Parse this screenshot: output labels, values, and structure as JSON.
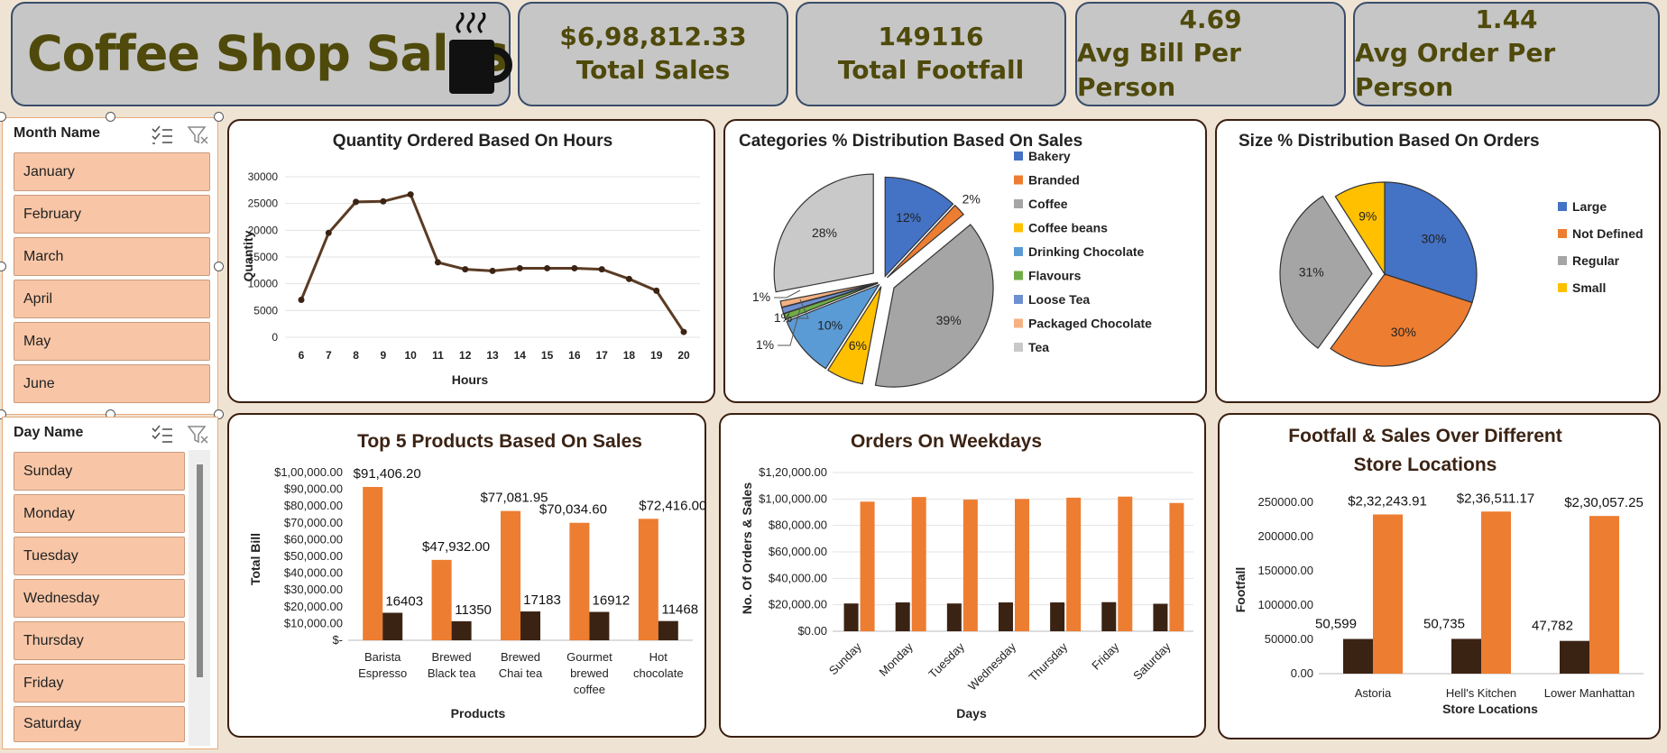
{
  "header": {
    "title": "Coffee Shop Sales",
    "icon": "coffee-cup-icon"
  },
  "kpis": [
    {
      "value": "$6,98,812.33",
      "label": "Total Sales"
    },
    {
      "value": "149116",
      "label": "Total Footfall"
    },
    {
      "value": "4.69",
      "label": "Avg Bill Per Person"
    },
    {
      "value": "1.44",
      "label": "Avg Order Per Person"
    }
  ],
  "slicers": {
    "month": {
      "header": "Month Name",
      "items": [
        "January",
        "February",
        "March",
        "April",
        "May",
        "June"
      ]
    },
    "day": {
      "header": "Day Name",
      "items": [
        "Sunday",
        "Monday",
        "Tuesday",
        "Wednesday",
        "Thursday",
        "Friday",
        "Saturday"
      ]
    }
  },
  "colors": {
    "orange": "#ed7d31",
    "dark_brown": "#3b2314",
    "line_brown": "#5b3b24",
    "title_olive": "#4f4a0b"
  },
  "chart_data": [
    {
      "type": "line",
      "title": "Quantity Ordered Based On Hours",
      "xlabel": "Hours",
      "ylabel": "Quantity",
      "x": [
        6,
        7,
        8,
        9,
        10,
        11,
        12,
        13,
        14,
        15,
        16,
        17,
        18,
        19,
        20
      ],
      "values": [
        7000,
        19500,
        25300,
        25400,
        26700,
        14000,
        12700,
        12400,
        12900,
        12900,
        12900,
        12700,
        10900,
        8700,
        1000
      ],
      "yticks": [
        "0",
        "5000",
        "10000",
        "15000",
        "20000",
        "25000",
        "30000"
      ],
      "ylim": [
        0,
        30000
      ]
    },
    {
      "type": "pie",
      "title": "Categories % Distribution Based On Sales",
      "categories": [
        "Bakery",
        "Branded",
        "Coffee",
        "Coffee beans",
        "Drinking Chocolate",
        "Flavours",
        "Loose Tea",
        "Packaged Chocolate",
        "Tea"
      ],
      "values": [
        12,
        2,
        39,
        6,
        10,
        1,
        1,
        1,
        28
      ],
      "labels": [
        "12%",
        "2%",
        "39%",
        "6%",
        "10%",
        "1%",
        "1%",
        "1%",
        "28%"
      ],
      "colors": [
        "#4472c4",
        "#ed7d31",
        "#a5a5a5",
        "#ffc000",
        "#5b9bd5",
        "#70ad47",
        "#6f8fd0",
        "#f4b183",
        "#c9c9c9"
      ],
      "legend": "right"
    },
    {
      "type": "pie",
      "title": "Size % Distribution Based On Orders",
      "categories": [
        "Large",
        "Not Defined",
        "Regular",
        "Small"
      ],
      "values": [
        30,
        30,
        31,
        9
      ],
      "labels": [
        "30%",
        "30%",
        "31%",
        "9%"
      ],
      "colors": [
        "#4472c4",
        "#ed7d31",
        "#a5a5a5",
        "#ffc000"
      ],
      "legend": "right"
    },
    {
      "type": "bar",
      "title": "Top 5 Products Based On Sales",
      "xlabel": "Products",
      "ylabel": "Total Bill",
      "categories": [
        [
          "Barista",
          "Espresso"
        ],
        [
          "Brewed",
          "Black tea"
        ],
        [
          "Brewed",
          "Chai tea"
        ],
        [
          "Gourmet",
          "brewed",
          "coffee"
        ],
        [
          "Hot",
          "chocolate"
        ]
      ],
      "series": [
        {
          "values": [
            91406.2,
            47932.0,
            77081.95,
            70034.6,
            72416.0
          ],
          "labels": [
            "$91,406.20",
            "$47,932.00",
            "$77,081.95",
            "$70,034.60",
            "$72,416.00"
          ]
        },
        {
          "values": [
            16403,
            11350,
            17183,
            16912,
            11468
          ],
          "labels": [
            "16403",
            "11350",
            "17183",
            "16912",
            "11468"
          ]
        }
      ],
      "yticks": [
        "$-",
        "$10,000.00",
        "$20,000.00",
        "$30,000.00",
        "$40,000.00",
        "$50,000.00",
        "$60,000.00",
        "$70,000.00",
        "$80,000.00",
        "$90,000.00",
        "$1,00,000.00"
      ],
      "ylim": [
        0,
        100000
      ]
    },
    {
      "type": "bar",
      "title": "Orders On Weekdays",
      "xlabel": "Days",
      "ylabel": "No. Of Orders & Sales",
      "categories": [
        "Sunday",
        "Monday",
        "Tuesday",
        "Wednesday",
        "Thursday",
        "Friday",
        "Saturday"
      ],
      "series": [
        {
          "values": [
            21000,
            21800,
            21000,
            21800,
            21800,
            22000,
            20800
          ]
        },
        {
          "values": [
            98000,
            101500,
            99500,
            100000,
            101000,
            101800,
            97000
          ]
        }
      ],
      "yticks": [
        "$0.00",
        "$20,000.00",
        "$40,000.00",
        "$60,000.00",
        "$80,000.00",
        "$1,00,000.00",
        "$1,20,000.00"
      ],
      "ylim": [
        0,
        120000
      ]
    },
    {
      "type": "bar",
      "title": "Footfall & Sales Over Different Store Locations",
      "xlabel": "Store Locations",
      "ylabel": "Footfall",
      "categories": [
        "Astoria",
        "Hell's Kitchen",
        "Lower Manhattan"
      ],
      "series": [
        {
          "values": [
            50599,
            50735,
            47782
          ],
          "labels": [
            "50,599",
            "50,735",
            "47,782"
          ]
        },
        {
          "values": [
            232243.91,
            236511.17,
            230057.25
          ],
          "labels": [
            "$2,32,243.91",
            "$2,36,511.17",
            "$2,30,057.25"
          ]
        }
      ],
      "yticks": [
        "0.00",
        "50000.00",
        "100000.00",
        "150000.00",
        "200000.00",
        "250000.00"
      ],
      "ylim": [
        0,
        250000
      ]
    }
  ]
}
